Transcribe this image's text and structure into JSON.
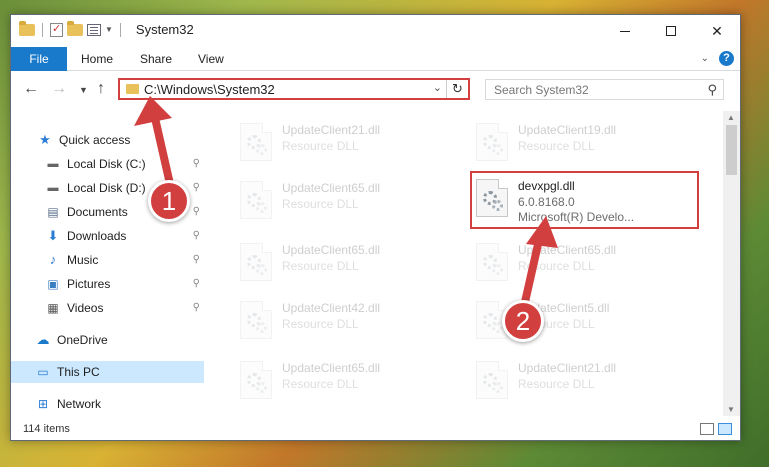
{
  "window": {
    "title": "System32",
    "controls": {
      "minimize": "minimize",
      "maximize": "maximize",
      "close": "✕"
    }
  },
  "ribbon": {
    "tabs": [
      "File",
      "Home",
      "Share",
      "View"
    ],
    "help": "?"
  },
  "navbar": {
    "address": "C:\\Windows\\System32",
    "search_placeholder": "Search System32"
  },
  "sidebar": {
    "items": [
      {
        "label": "Quick access",
        "icon": "star-icon"
      },
      {
        "label": "Local Disk (C:)",
        "icon": "drive-icon",
        "pinned": true
      },
      {
        "label": "Local Disk (D:)",
        "icon": "drive-icon",
        "pinned": true
      },
      {
        "label": "Documents",
        "icon": "documents-icon",
        "pinned": true
      },
      {
        "label": "Downloads",
        "icon": "download-icon",
        "pinned": true
      },
      {
        "label": "Music",
        "icon": "music-icon",
        "pinned": true
      },
      {
        "label": "Pictures",
        "icon": "pictures-icon",
        "pinned": true
      },
      {
        "label": "Videos",
        "icon": "videos-icon",
        "pinned": true
      },
      {
        "label": "OneDrive",
        "icon": "cloud-icon"
      },
      {
        "label": "This PC",
        "icon": "computer-icon",
        "selected": true
      },
      {
        "label": "Network",
        "icon": "network-icon"
      }
    ]
  },
  "files": [
    {
      "name": "UpdateClient21.dll",
      "line2": "Resource DLL",
      "line3": ""
    },
    {
      "name": "UpdateClient19.dll",
      "line2": "Resource DLL",
      "line3": ""
    },
    {
      "name": "UpdateClient65.dll",
      "line2": "Resource DLL",
      "line3": ""
    },
    {
      "name": "devxpgl.dll",
      "line2": "6.0.8168.0",
      "line3": "Microsoft(R) Develo..."
    },
    {
      "name": "UpdateClient65.dll",
      "line2": "Resource DLL",
      "line3": ""
    },
    {
      "name": "UpdateClient65.dll",
      "line2": "Resource DLL",
      "line3": ""
    },
    {
      "name": "UpdateClient42.dll",
      "line2": "Resource DLL",
      "line3": ""
    },
    {
      "name": "UpdateClient5.dll",
      "line2": "Resource DLL",
      "line3": ""
    },
    {
      "name": "UpdateClient65.dll",
      "line2": "Resource DLL",
      "line3": ""
    },
    {
      "name": "UpdateClient21.dll",
      "line2": "Resource DLL",
      "line3": ""
    }
  ],
  "status": {
    "item_count": "114 items"
  },
  "annotations": {
    "badge1": "1",
    "badge2": "2"
  },
  "colors": {
    "accent": "#1979ca",
    "highlight": "#d23f3f",
    "selected": "#cce8ff"
  }
}
